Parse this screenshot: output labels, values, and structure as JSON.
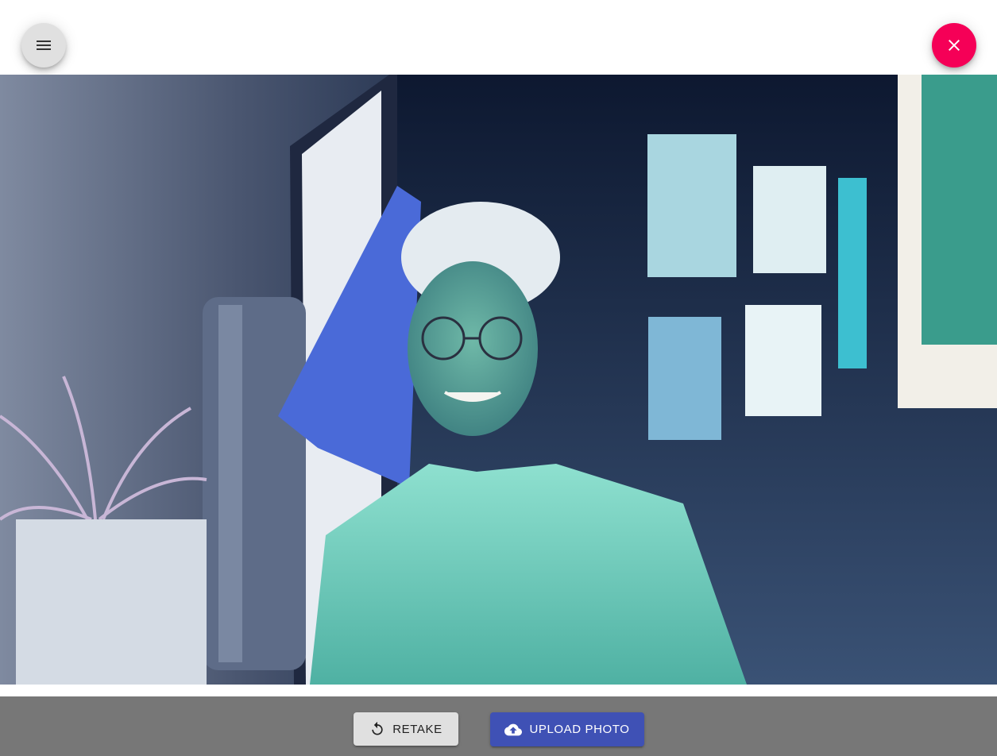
{
  "topbar": {
    "menu_icon": "hamburger-menu-icon",
    "close_icon": "close-icon",
    "close_color": "#f50057"
  },
  "photo": {
    "description_icon": "captured-webcam-photo-inverted-colors"
  },
  "actions": {
    "retake_label": "Retake",
    "retake_icon": "refresh-icon",
    "upload_label": "Upload Photo",
    "upload_icon": "cloud-upload-icon",
    "upload_color": "#3f51b5"
  }
}
